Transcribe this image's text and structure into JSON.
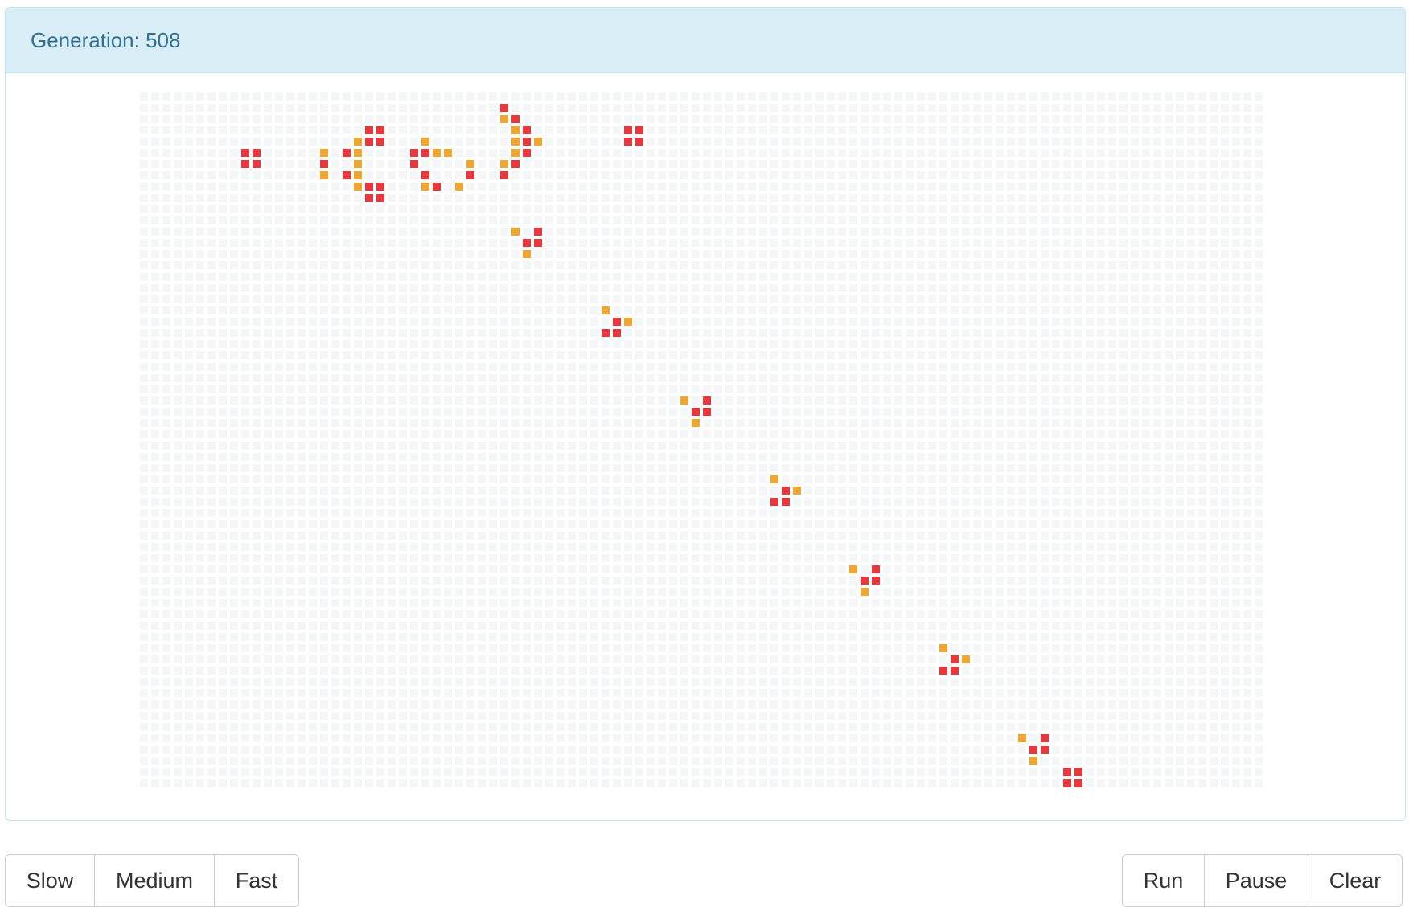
{
  "header": {
    "generation_text": "Generation: 508"
  },
  "board": {
    "cols": 100,
    "rows": 62,
    "colors": {
      "empty": "#f5f6f7",
      "alive": "#e8383d",
      "young": "#f0a732"
    },
    "cells": [
      [
        32,
        1,
        "a"
      ],
      [
        33,
        2,
        "a"
      ],
      [
        32,
        2,
        "y"
      ],
      [
        20,
        3,
        "a"
      ],
      [
        21,
        3,
        "a"
      ],
      [
        33,
        3,
        "y"
      ],
      [
        34,
        3,
        "a"
      ],
      [
        43,
        3,
        "a"
      ],
      [
        44,
        3,
        "a"
      ],
      [
        19,
        4,
        "y"
      ],
      [
        20,
        4,
        "a"
      ],
      [
        21,
        4,
        "a"
      ],
      [
        25,
        4,
        "y"
      ],
      [
        33,
        4,
        "y"
      ],
      [
        34,
        4,
        "a"
      ],
      [
        35,
        4,
        "y"
      ],
      [
        43,
        4,
        "a"
      ],
      [
        44,
        4,
        "a"
      ],
      [
        9,
        5,
        "a"
      ],
      [
        10,
        5,
        "a"
      ],
      [
        16,
        5,
        "y"
      ],
      [
        18,
        5,
        "a"
      ],
      [
        19,
        5,
        "y"
      ],
      [
        24,
        5,
        "a"
      ],
      [
        25,
        5,
        "a"
      ],
      [
        26,
        5,
        "y"
      ],
      [
        27,
        5,
        "y"
      ],
      [
        33,
        5,
        "y"
      ],
      [
        34,
        5,
        "a"
      ],
      [
        9,
        6,
        "a"
      ],
      [
        10,
        6,
        "a"
      ],
      [
        16,
        6,
        "a"
      ],
      [
        19,
        6,
        "y"
      ],
      [
        24,
        6,
        "a"
      ],
      [
        29,
        6,
        "y"
      ],
      [
        32,
        6,
        "y"
      ],
      [
        33,
        6,
        "a"
      ],
      [
        16,
        7,
        "y"
      ],
      [
        18,
        7,
        "a"
      ],
      [
        19,
        7,
        "y"
      ],
      [
        25,
        7,
        "a"
      ],
      [
        29,
        7,
        "a"
      ],
      [
        32,
        7,
        "a"
      ],
      [
        19,
        8,
        "y"
      ],
      [
        20,
        8,
        "a"
      ],
      [
        21,
        8,
        "a"
      ],
      [
        25,
        8,
        "y"
      ],
      [
        26,
        8,
        "a"
      ],
      [
        28,
        8,
        "y"
      ],
      [
        20,
        9,
        "a"
      ],
      [
        21,
        9,
        "a"
      ],
      [
        33,
        12,
        "y"
      ],
      [
        35,
        12,
        "a"
      ],
      [
        34,
        13,
        "a"
      ],
      [
        35,
        13,
        "a"
      ],
      [
        34,
        14,
        "y"
      ],
      [
        41,
        19,
        "y"
      ],
      [
        42,
        20,
        "a"
      ],
      [
        43,
        20,
        "y"
      ],
      [
        41,
        21,
        "a"
      ],
      [
        42,
        21,
        "a"
      ],
      [
        48,
        27,
        "y"
      ],
      [
        50,
        27,
        "a"
      ],
      [
        49,
        28,
        "a"
      ],
      [
        50,
        28,
        "a"
      ],
      [
        49,
        29,
        "y"
      ],
      [
        56,
        34,
        "y"
      ],
      [
        57,
        35,
        "a"
      ],
      [
        58,
        35,
        "y"
      ],
      [
        56,
        36,
        "a"
      ],
      [
        57,
        36,
        "a"
      ],
      [
        63,
        42,
        "y"
      ],
      [
        65,
        42,
        "a"
      ],
      [
        64,
        43,
        "a"
      ],
      [
        65,
        43,
        "a"
      ],
      [
        64,
        44,
        "y"
      ],
      [
        71,
        49,
        "y"
      ],
      [
        72,
        50,
        "a"
      ],
      [
        73,
        50,
        "y"
      ],
      [
        71,
        51,
        "a"
      ],
      [
        72,
        51,
        "a"
      ],
      [
        78,
        57,
        "y"
      ],
      [
        80,
        57,
        "a"
      ],
      [
        79,
        58,
        "a"
      ],
      [
        80,
        58,
        "a"
      ],
      [
        79,
        59,
        "y"
      ],
      [
        82,
        60,
        "a"
      ],
      [
        83,
        60,
        "a"
      ],
      [
        82,
        61,
        "a"
      ],
      [
        83,
        61,
        "a"
      ]
    ]
  },
  "speed_controls": {
    "slow": "Slow",
    "medium": "Medium",
    "fast": "Fast"
  },
  "run_controls": {
    "run": "Run",
    "pause": "Pause",
    "clear": "Clear"
  }
}
